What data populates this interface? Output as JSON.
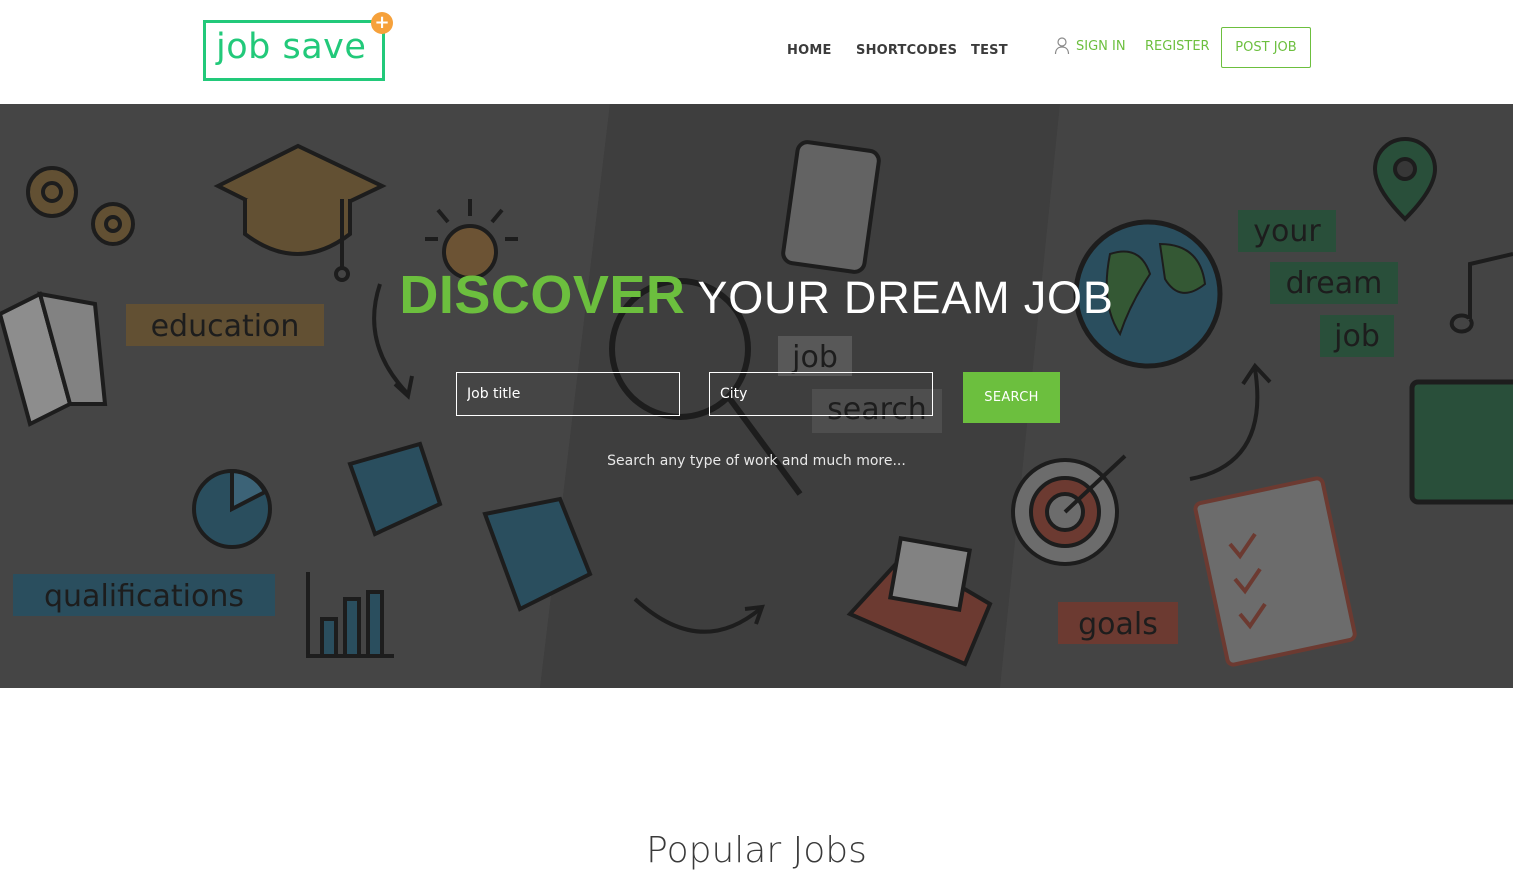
{
  "header": {
    "logo_text": "job save",
    "logo_plus": "+",
    "nav": {
      "home": "HOME",
      "shortcodes": "SHORTCODES",
      "test": "TEST"
    },
    "auth": {
      "user_icon": "user-icon",
      "sign_in": "SIGN IN",
      "register": "REGISTER",
      "post_job": "POST JOB"
    }
  },
  "hero": {
    "title_accent": "DISCOVER",
    "title_rest": "YOUR DREAM JOB",
    "job_placeholder": "Job title",
    "city_placeholder": "City",
    "search_label": "SEARCH",
    "subtitle": "Search any type of work and much more...",
    "background_words": {
      "education": "education",
      "qualifications": "qualifications",
      "job": "job",
      "search": "search",
      "your": "your",
      "dream": "dream",
      "job2": "job",
      "goals": "goals"
    }
  },
  "section": {
    "popular_title": "Popular Jobs"
  },
  "colors": {
    "accent": "#6cbf3e",
    "logo": "#22c97a",
    "logo_plus": "#f6a13b"
  }
}
